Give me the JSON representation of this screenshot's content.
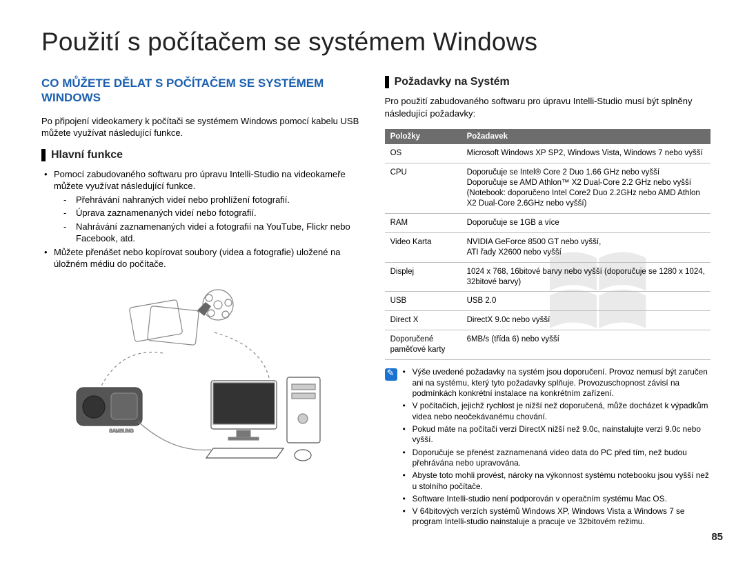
{
  "title": "Použití s počítačem se systémem Windows",
  "pageNumber": "85",
  "left": {
    "sectionHeading": "CO MŮŽETE DĚLAT S POČÍTAČEM SE SYSTÉMEM WINDOWS",
    "intro": "Po připojení videokamery k počítači se systémem Windows pomocí kabelu USB můžete využívat následující funkce.",
    "subHeading": "Hlavní funkce",
    "bullet1": "Pomocí zabudovaného softwaru pro úpravu Intelli-Studio na videokameře můžete využívat následující funkce.",
    "dash1": "Přehrávání nahraných videí nebo prohlížení fotografií.",
    "dash2": "Úprava zaznamenaných videí nebo fotografií.",
    "dash3": "Nahrávání zaznamenaných videí a fotografií na YouTube, Flickr nebo Facebook, atd.",
    "bullet2": "Můžete přenášet nebo kopírovat soubory (videa a fotografie) uložené na úložném médiu do počítače."
  },
  "right": {
    "subHeading": "Požadavky na Systém",
    "intro": "Pro použití zabudovaného softwaru pro úpravu Intelli-Studio musí být splněny následující požadavky:",
    "th1": "Položky",
    "th2": "Požadavek",
    "rows": [
      {
        "item": "OS",
        "req": "Microsoft Windows XP SP2, Windows Vista, Windows 7 nebo vyšší"
      },
      {
        "item": "CPU",
        "req": "Doporučuje se Intel® Core 2 Duo 1.66 GHz nebo vyšší\nDoporučuje se AMD Athlon™ X2 Dual-Core 2.2 GHz nebo vyšší\n(Notebook: doporučeno Intel Core2 Duo 2.2GHz nebo AMD Athlon X2 Dual-Core 2.6GHz nebo vyšší)"
      },
      {
        "item": "RAM",
        "req": "Doporučuje se 1GB a více"
      },
      {
        "item": "Video Karta",
        "req": "NVIDIA GeForce 8500 GT nebo vyšší,\nATI řady X2600 nebo vyšší"
      },
      {
        "item": "Displej",
        "req": "1024 x 768, 16bitové barvy nebo vyšší (doporučuje se 1280 x 1024, 32bitové barvy)"
      },
      {
        "item": "USB",
        "req": "USB 2.0"
      },
      {
        "item": "Direct X",
        "req": "DirectX 9.0c nebo vyšší"
      },
      {
        "item": "Doporučené paměťové karty",
        "req": "6MB/s (třída 6) nebo vyšší"
      }
    ],
    "notes": [
      "Výše uvedené požadavky na systém jsou doporučení. Provoz nemusí být zaručen ani na systému, který tyto požadavky splňuje. Provozuschopnost závisí na podmínkách konkrétní instalace na konkrétním zařízení.",
      "V počítačích, jejichž rychlost je nižší než doporučená, může docházet k výpadkům videa nebo neočekávanému chování.",
      "Pokud máte na počítači verzi DirectX nižší než 9.0c, nainstalujte verzi 9.0c nebo vyšší.",
      "Doporučuje se přenést zaznamenaná video data do PC před tím, než budou přehrávána nebo upravována.",
      "Abyste toto mohli provést, nároky na výkonnost systému notebooku jsou vyšší než u stolního počítače.",
      "Software Intelli-studio není podporován v operačním systému Mac OS.",
      "V 64bitových verzích systémů Windows XP, Windows Vista a Windows 7 se program Intelli-studio nainstaluje a pracuje ve 32bitovém režimu."
    ]
  }
}
